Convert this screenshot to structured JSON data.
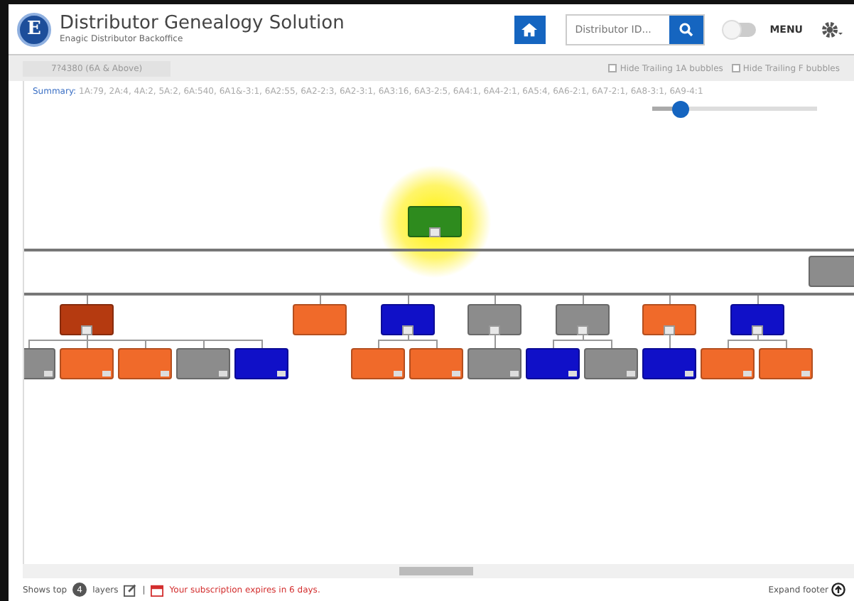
{
  "header": {
    "title": "Distributor Genealogy Solution",
    "subtitle": "Enagic Distributor Backoffice",
    "logo_letter": "E",
    "search": {
      "placeholder": "Distributor ID..."
    },
    "menu_toggle": {
      "on": false
    },
    "menu_label": "MENU"
  },
  "filter_bar": {
    "rank_label": "7?4380 (6A & Above)",
    "options": [
      {
        "label": "Hide Trailing 1A bubbles",
        "checked": false
      },
      {
        "label": "Hide Trailing F bubbles",
        "checked": false
      }
    ]
  },
  "summary": {
    "label": "Summary:",
    "text": "1A:79, 2A:4, 4A:2, 5A:2, 6A:540, 6A1&-3:1, 6A2:55, 6A2-2:3, 6A2-3:1, 6A3:16, 6A3-2:5, 6A4:1, 6A4-2:1, 6A5:4, 6A6-2:1, 6A7-2:1, 6A8-3:1, 6A9-4:1"
  },
  "zoom_slider": {
    "level": 0.17
  },
  "tree": {
    "color": "#2e8b1e",
    "highlighted": true,
    "children": [
      {
        "color": "#b53a10",
        "children": [
          {
            "color": "#8c8c8c"
          },
          {
            "color": "#f06a2a"
          },
          {
            "color": "#f06a2a"
          },
          {
            "color": "#8c8c8c"
          },
          {
            "color": "#1010c8"
          }
        ]
      },
      {
        "color": "#f06a2a"
      },
      {
        "color": "#1010c8",
        "children": [
          {
            "color": "#f06a2a"
          },
          {
            "color": "#f06a2a"
          }
        ]
      },
      {
        "color": "#8c8c8c",
        "children": [
          {
            "color": "#8c8c8c"
          }
        ]
      },
      {
        "color": "#8c8c8c",
        "children": [
          {
            "color": "#1010c8"
          },
          {
            "color": "#8c8c8c"
          }
        ]
      },
      {
        "color": "#f06a2a",
        "children": [
          {
            "color": "#1010c8"
          }
        ]
      },
      {
        "color": "#1010c8",
        "children": [
          {
            "color": "#f06a2a"
          },
          {
            "color": "#f06a2a"
          }
        ]
      }
    ]
  },
  "side_node": {
    "color": "#8c8c8c"
  },
  "footer": {
    "shows_prefix": "Shows top",
    "layers_count": "4",
    "layers_suffix": "layers",
    "separator": "|",
    "subscription": "Your subscription expires in 6 days.",
    "expand": "Expand footer"
  }
}
